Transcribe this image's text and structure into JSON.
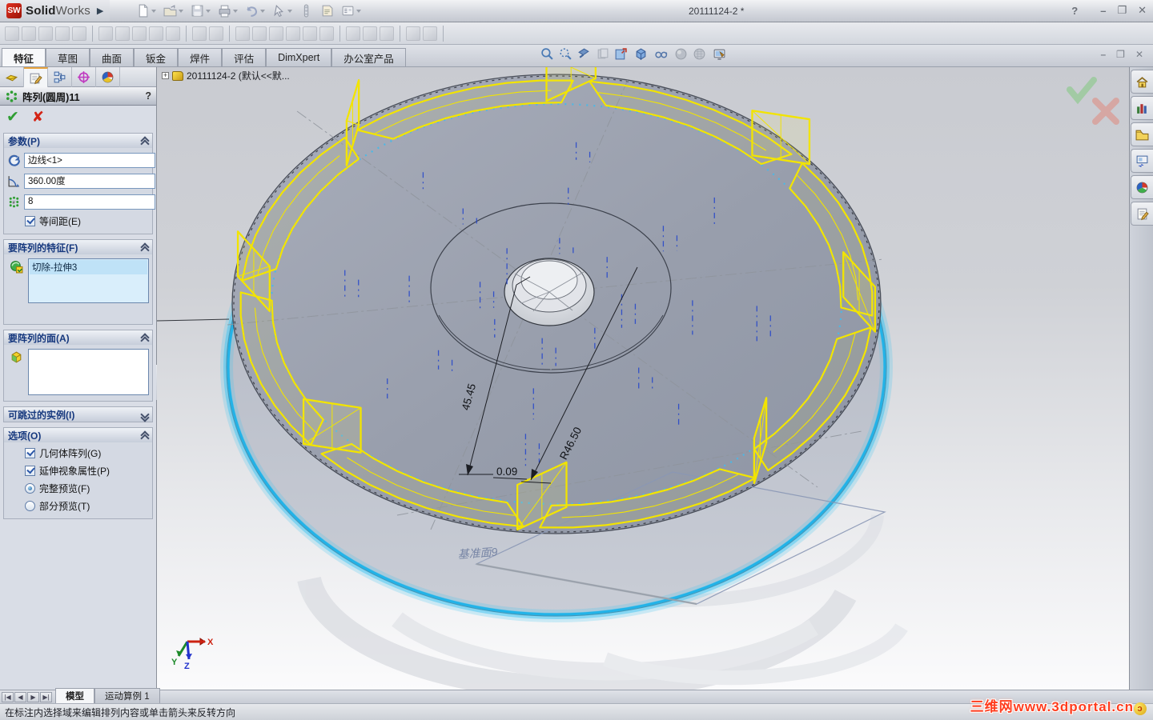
{
  "window": {
    "brand_solid": "Solid",
    "brand_works": "Works",
    "title": "20111124-2 *",
    "help_label": "?",
    "minimize_label": "–",
    "restore_label": "❐",
    "close_label": "✕"
  },
  "command_tabs": [
    "特征",
    "草图",
    "曲面",
    "钣金",
    "焊件",
    "评估",
    "DimXpert",
    "办公室产品"
  ],
  "command_tabs_active": "特征",
  "doc_window": {
    "minimize_label": "–",
    "restore_label": "❐",
    "close_label": "✕"
  },
  "tree": {
    "root_label": "20111124-2  (默认<<默...",
    "expand_glyph": "+"
  },
  "property_manager": {
    "title": "阵列(圆周)11",
    "help_label": "?",
    "params": {
      "header": "参数(P)",
      "direction_value": "边线<1>",
      "angle_value": "360.00度",
      "count_value": "8",
      "equal_spacing_label": "等间距(E)"
    },
    "features": {
      "header": "要阵列的特征(F)",
      "item": "切除-拉伸3"
    },
    "faces": {
      "header": "要阵列的面(A)"
    },
    "skip": {
      "header": "可跳过的实例(I)"
    },
    "options": {
      "header": "选项(O)",
      "geometry_pattern_label": "几何体阵列(G)",
      "propagate_visual_label": "延伸视象属性(P)",
      "full_preview_label": "完整预览(F)",
      "partial_preview_label": "部分预览(T)"
    }
  },
  "annotations": {
    "dim_length": "45.45",
    "dim_radius": "R46.50",
    "dim_offset": "0.09",
    "plane_label": "基准面9"
  },
  "axes": {
    "x": "X",
    "y": "Y",
    "z": "Z"
  },
  "doc_tabs": {
    "model": "模型",
    "motion_study": "运动算例 1"
  },
  "statusbar": {
    "message": "在标注内选择域来编辑排列内容或单击箭头来反转方向"
  },
  "watermark": {
    "text": "三维网www.3dportal.cn",
    "logo_glyph": "ɔ"
  },
  "colors": {
    "highlight_cyan": "#35c2f2",
    "preview_yellow": "#f2e400",
    "axis_blue": "#2244cc",
    "face_gray": "#9aa0ae"
  }
}
